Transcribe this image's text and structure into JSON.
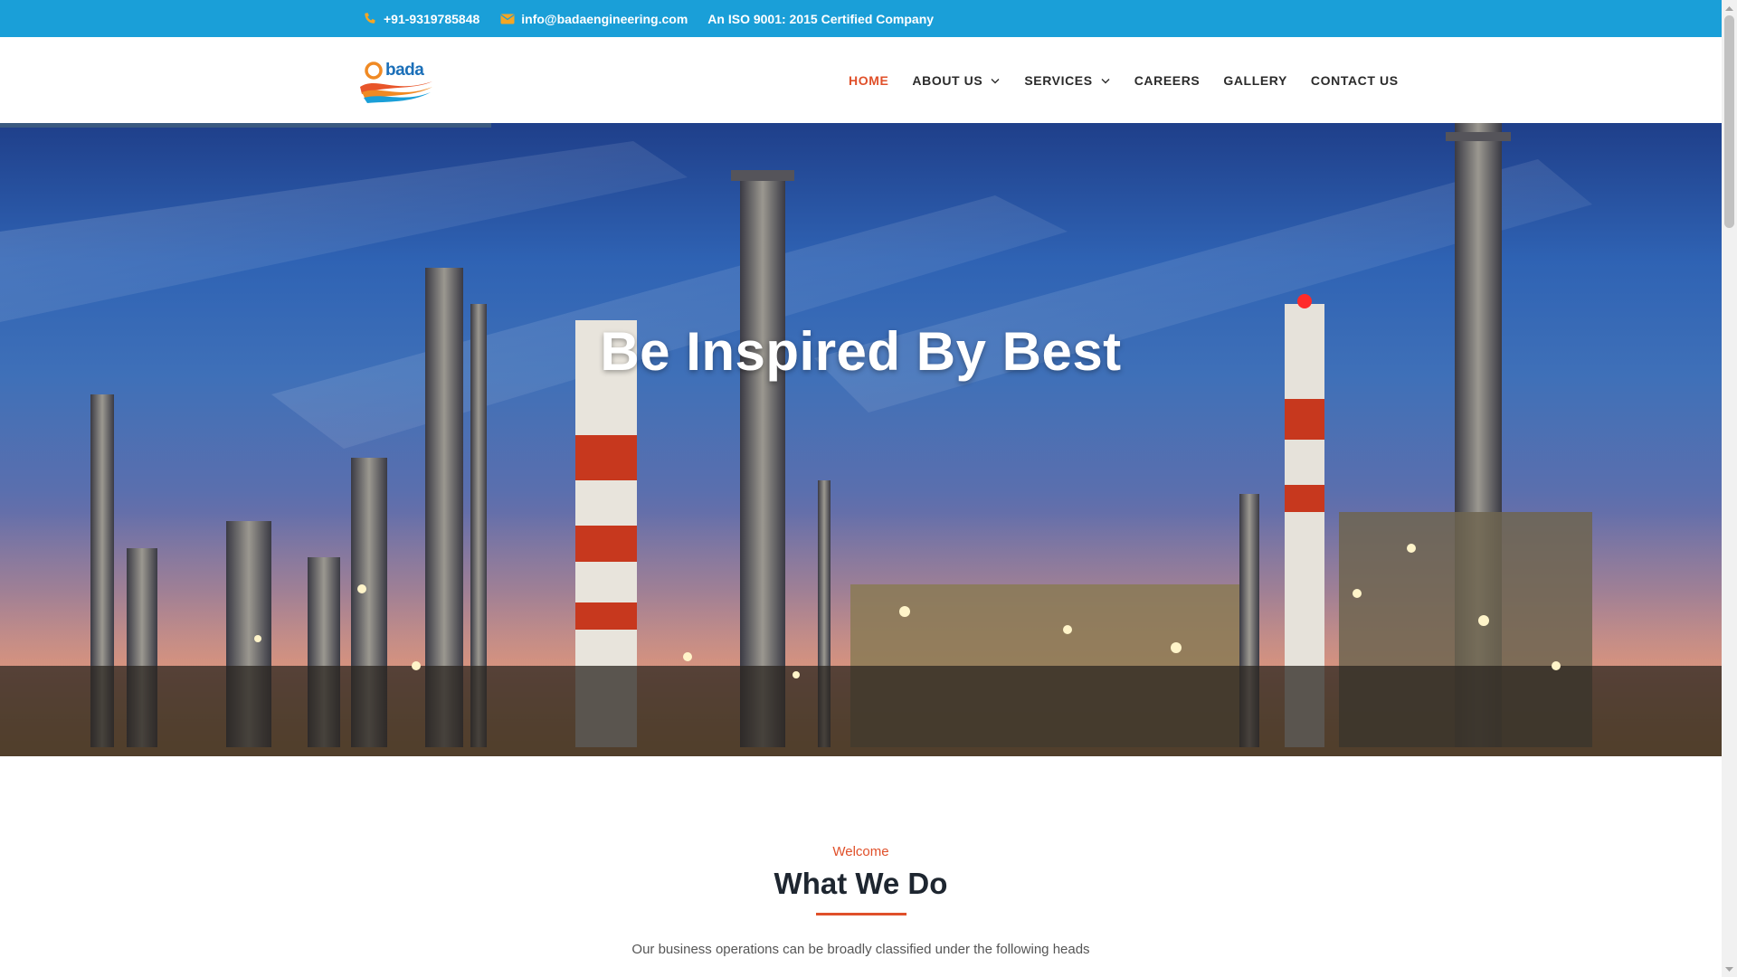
{
  "topbar": {
    "phone": "+91-9319785848",
    "email": "info@badaengineering.com",
    "certification": "An ISO 9001: 2015 Certified Company",
    "phone_icon": "phone-icon",
    "email_icon": "envelope-icon",
    "background_color": "#1a9fd8",
    "icon_color": "#f5a623"
  },
  "header": {
    "logo_text": "bada",
    "nav": [
      {
        "label": "HOME",
        "active": true,
        "dropdown": false
      },
      {
        "label": "ABOUT US",
        "active": false,
        "dropdown": true
      },
      {
        "label": "SERVICES",
        "active": false,
        "dropdown": true
      },
      {
        "label": "CAREERS",
        "active": false,
        "dropdown": false
      },
      {
        "label": "GALLERY",
        "active": false,
        "dropdown": false
      },
      {
        "label": "CONTACT US",
        "active": false,
        "dropdown": false
      }
    ],
    "active_color": "#e0502a"
  },
  "hero": {
    "title": "Be Inspired By Best"
  },
  "welcome": {
    "kicker": "Welcome",
    "heading": "What We Do",
    "description": "Our business operations can be broadly classified under the following heads",
    "accent_color": "#e0502a"
  }
}
